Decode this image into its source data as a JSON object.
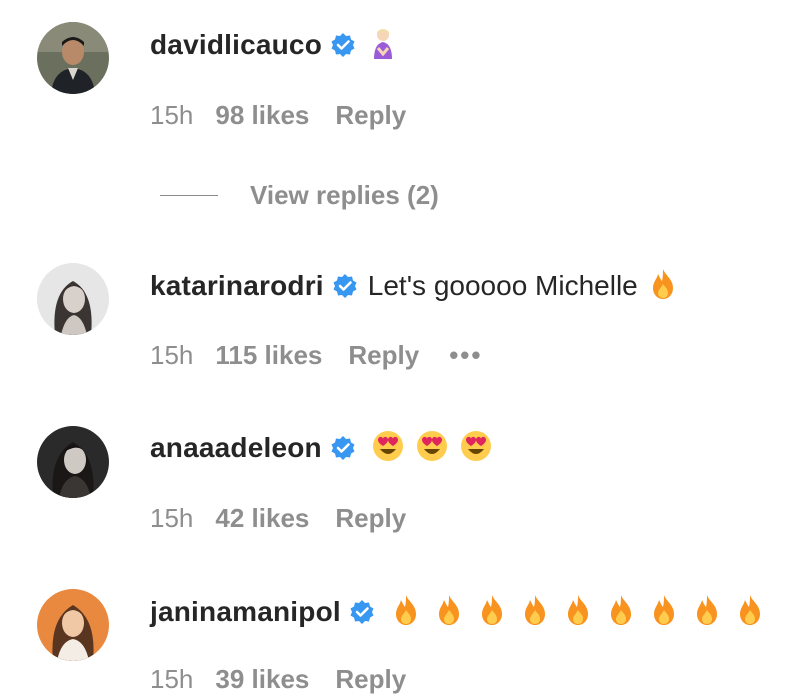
{
  "comments": [
    {
      "username": "davidlicauco",
      "text": "",
      "emojis": [
        "bow-emoji"
      ],
      "time": "15h",
      "likes": "98 likes",
      "reply": "Reply",
      "view_replies": "View replies (2)"
    },
    {
      "username": "katarinarodri",
      "text": "Let's gooooo Michelle",
      "emojis": [
        "fire-emoji"
      ],
      "time": "15h",
      "likes": "115 likes",
      "reply": "Reply",
      "more": "•••"
    },
    {
      "username": "anaaadeleon",
      "text": "",
      "emojis": [
        "heart-eyes-emoji",
        "heart-eyes-emoji",
        "heart-eyes-emoji"
      ],
      "time": "15h",
      "likes": "42 likes",
      "reply": "Reply"
    },
    {
      "username": "janinamanipol",
      "text": "",
      "emojis": [
        "fire-emoji",
        "fire-emoji",
        "fire-emoji",
        "fire-emoji",
        "fire-emoji",
        "fire-emoji",
        "fire-emoji",
        "fire-emoji",
        "fire-emoji"
      ],
      "time": "15h",
      "likes": "39 likes",
      "reply": "Reply"
    }
  ],
  "colors": {
    "username": "#262626",
    "meta": "#8e8e8e",
    "verified": "#3897f0",
    "fire": "#f7931e",
    "heart_eyes_face": "#ffcc4d",
    "heart": "#e0245e"
  }
}
